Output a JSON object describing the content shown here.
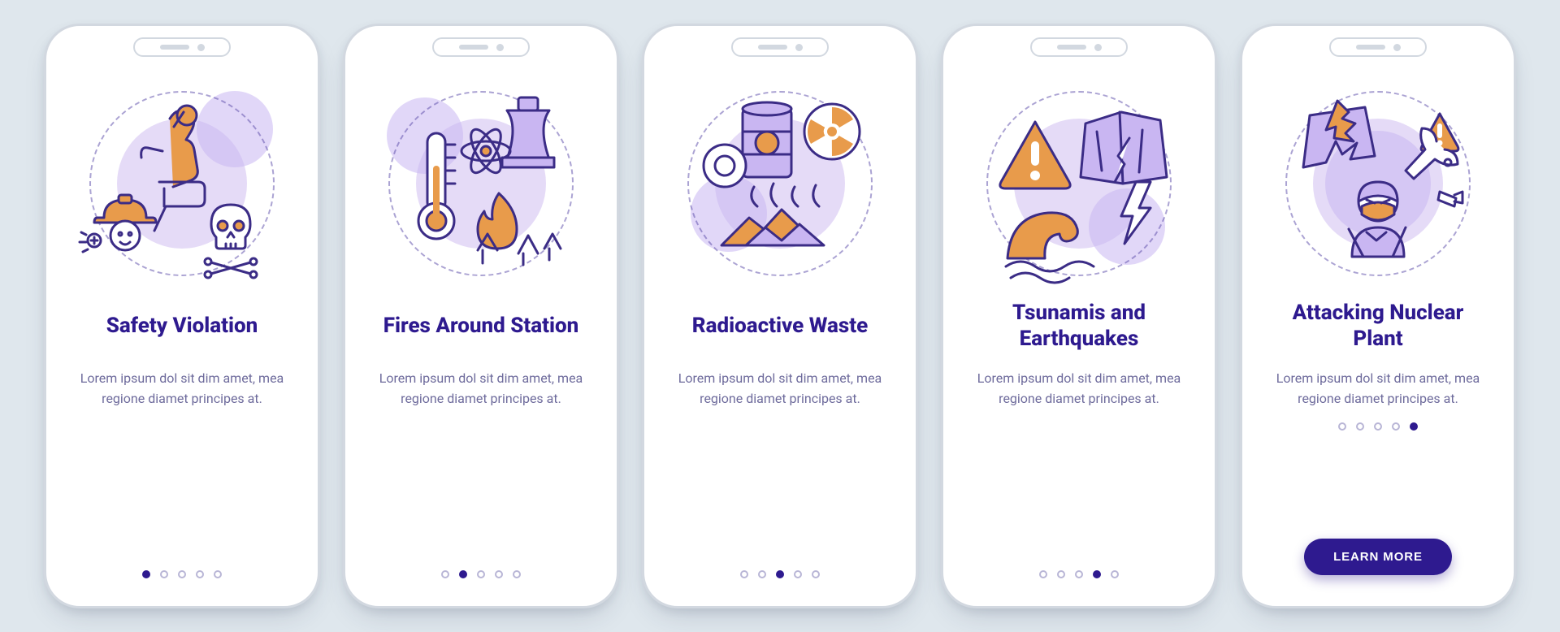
{
  "colors": {
    "bg": "#dfe7ed",
    "card": "#ffffff",
    "heading": "#2e1a8f",
    "body": "#6e6b9c",
    "accent": "#e89b4b",
    "lilac": "#c9b6f2",
    "lilacSoft": "#e5dbf7",
    "stroke": "#3b2c86"
  },
  "common": {
    "description": "Lorem ipsum dol sit dim amet, mea regione diamet principes at.",
    "cta_label": "LEARN MORE",
    "dot_count": 5
  },
  "cards": [
    {
      "id": "safety-violation",
      "title": "Safety Violation",
      "active_dot": 0,
      "illustration": "safety",
      "cta": false
    },
    {
      "id": "fires-around-station",
      "title": "Fires Around Station",
      "active_dot": 1,
      "illustration": "fires",
      "cta": false
    },
    {
      "id": "radioactive-waste",
      "title": "Radioactive Waste",
      "active_dot": 2,
      "illustration": "waste",
      "cta": false
    },
    {
      "id": "tsunamis-earthquakes",
      "title": "Tsunamis and Earthquakes",
      "active_dot": 3,
      "illustration": "tsunami",
      "cta": false
    },
    {
      "id": "attacking-nuclear-plant",
      "title": "Attacking Nuclear Plant",
      "active_dot": 4,
      "illustration": "attack",
      "cta": true
    }
  ],
  "illustration_icons": {
    "safety": [
      "relaxing-person-icon",
      "hardhat-worker-icon",
      "skull-crossbones-icon"
    ],
    "fires": [
      "thermometer-icon",
      "atom-icon",
      "cooling-tower-icon",
      "forest-fire-icon"
    ],
    "waste": [
      "radioactive-barrel-icon",
      "radiation-symbol-icon",
      "waste-pile-icon",
      "fumes-icon"
    ],
    "tsunami": [
      "warning-triangle-icon",
      "cracked-building-icon",
      "wave-icon",
      "lightning-icon"
    ],
    "attack": [
      "broken-structure-icon",
      "missile-icon",
      "bomb-icon",
      "masked-attacker-icon",
      "warning-triangle-icon"
    ]
  }
}
